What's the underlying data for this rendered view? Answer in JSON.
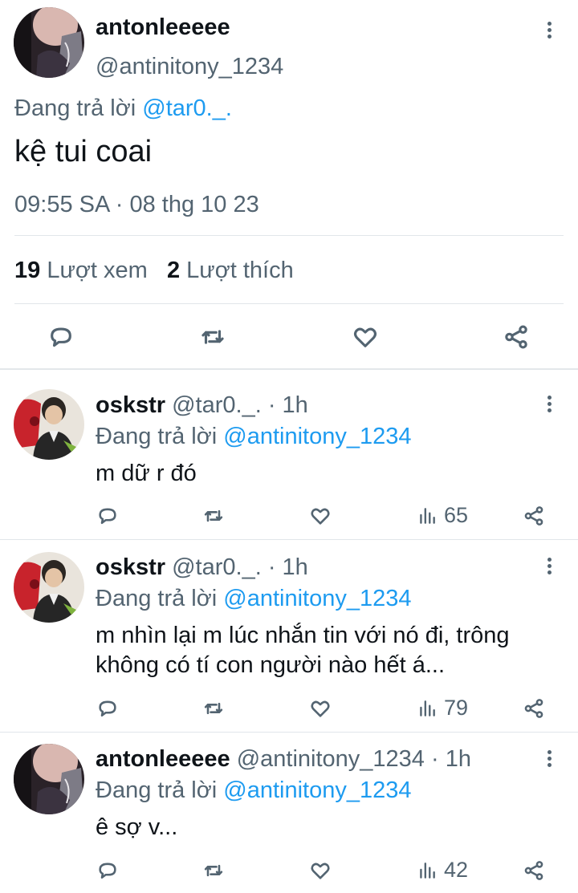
{
  "main_tweet": {
    "display_name": "antonleeeee",
    "handle": "@antinitony_1234",
    "reply_prefix": "Đang trả lời",
    "reply_to": "@tar0._.",
    "text": "kệ tui coai",
    "timestamp": "09:55 SA · 08 thg 10 23",
    "views_count": "19",
    "views_label": "Lượt xem",
    "likes_count": "2",
    "likes_label": "Lượt thích"
  },
  "replies": [
    {
      "display_name": "oskstr",
      "meta": "@tar0._. · 1h",
      "reply_prefix": "Đang trả lời",
      "reply_to": "@antinitony_1234",
      "text": "m dữ r đó",
      "views": "65"
    },
    {
      "display_name": "oskstr",
      "meta": "@tar0._. · 1h",
      "reply_prefix": "Đang trả lời",
      "reply_to": "@antinitony_1234",
      "text": "m nhìn lại m lúc nhắn tin với nó đi, trông không có tí con người nào hết á...",
      "views": "79"
    },
    {
      "display_name": "antonleeeee",
      "meta": "@antinitony_1234 · 1h",
      "reply_prefix": "Đang trả lời",
      "reply_to": "@antinitony_1234",
      "text": "ê sợ v...",
      "views": "42"
    }
  ],
  "colors": {
    "accent": "#1d9bf0",
    "secondary_text": "#536471",
    "primary_text": "#0f1419"
  }
}
